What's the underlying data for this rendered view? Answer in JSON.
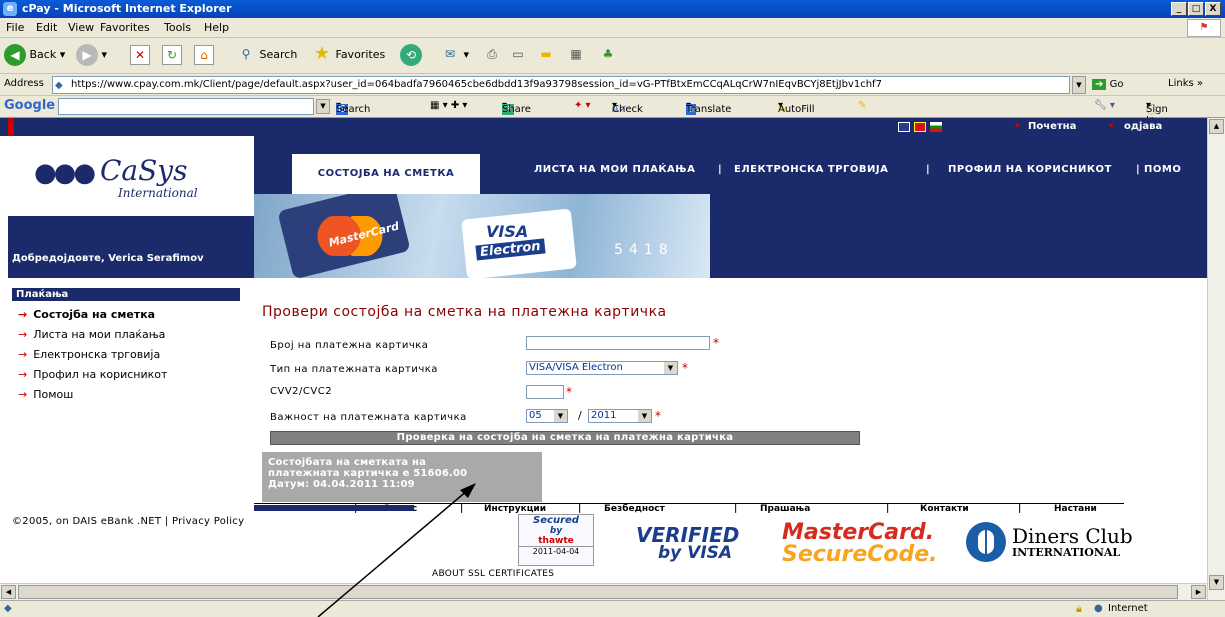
{
  "window": {
    "title": "cPay - Microsoft Internet Explorer",
    "min": "_",
    "max": "□",
    "close": "X"
  },
  "menu": [
    "File",
    "Edit",
    "View",
    "Favorites",
    "Tools",
    "Help"
  ],
  "toolbar": {
    "back": "Back",
    "search": "Search",
    "favorites": "Favorites"
  },
  "address": {
    "label": "Address",
    "url": "https://www.cpay.com.mk/Client/page/default.aspx?user_id=064badfa7960465cbe6dbdd13f9a93798session_id=vG-PTfBtxEmCCqALqCrW7nIEqvBCYj8EtjJbv1chf7",
    "go": "Go",
    "links": "Links"
  },
  "googlebar": {
    "logo": "Google",
    "search": "Search",
    "share": "Share",
    "check": "Check",
    "translate": "Translate",
    "autofill": "AutoFill",
    "signin": "Sign In"
  },
  "site": {
    "top_links": {
      "home": "Почетна",
      "logout": "одјава"
    },
    "logo": {
      "main": "CaSys",
      "sub": "International"
    },
    "welcome": "Добредојдовте, Verica Serafimov",
    "nav": {
      "account_state": "СОСТОЈБА НА СМЕТКА",
      "my_payments": "ЛИСТА НА МОИ ПЛАЌАЊА",
      "ecommerce": "ЕЛЕКТРОНСКА ТРГОВИЈА",
      "profile": "ПРОФИЛ НА КОРИСНИКОТ",
      "help": "ПОМО"
    },
    "banner": {
      "card1": "MasterCard",
      "card2": "VISA",
      "card2b": "Electron",
      "digits": "5418"
    },
    "sidebar": {
      "header": "Плаќања",
      "items": [
        "Состојба на сметка",
        "Листа на мои плаќања",
        "Електронска трговија",
        "Профил на корисникот",
        "Помош"
      ]
    },
    "form": {
      "title": "Провери состојба на сметка на платежна картичка",
      "card_number_label": "Број на платежна картичка",
      "card_number_value": "",
      "card_type_label": "Тип на платежната картичка",
      "card_type_value": "VISA/VISA Electron",
      "cvv_label": "CVV2/CVC2",
      "cvv_value": "",
      "expiry_label": "Важност на платежната картичка",
      "expiry_month": "05",
      "expiry_sep": "/",
      "expiry_year": "2011",
      "required": "*",
      "submit": "Проверка на состојба на сметка на платежна картичка"
    },
    "result": {
      "line1": "Состојбата на сметката на",
      "line2": "платежната картичка е 51606.00",
      "line3": "Датум: 04.04.2011 11:09"
    },
    "footer_links": [
      "За нас",
      "Инструкции",
      "Безбедност",
      "Прашања",
      "Контакти",
      "Настани"
    ],
    "copyright": "©2005, on DAIS eBank .NET | Privacy Policy",
    "ssl": {
      "secured": "Secured",
      "by": "by",
      "brand": "thawte",
      "date": "2011-04-04",
      "about": "ABOUT SSL CERTIFICATES"
    },
    "logos": {
      "verified1": "VERIFIED",
      "verified2": "by VISA",
      "mc1": "MasterCard.",
      "mc2": "SecureCode.",
      "diners1": "Diners Club",
      "diners2": "INTERNATIONAL"
    }
  },
  "status": {
    "zone": "Internet"
  },
  "colors": {
    "navy": "#1b2a6b",
    "title_red": "#8b0000",
    "result_gray": "#a9a9a9"
  }
}
